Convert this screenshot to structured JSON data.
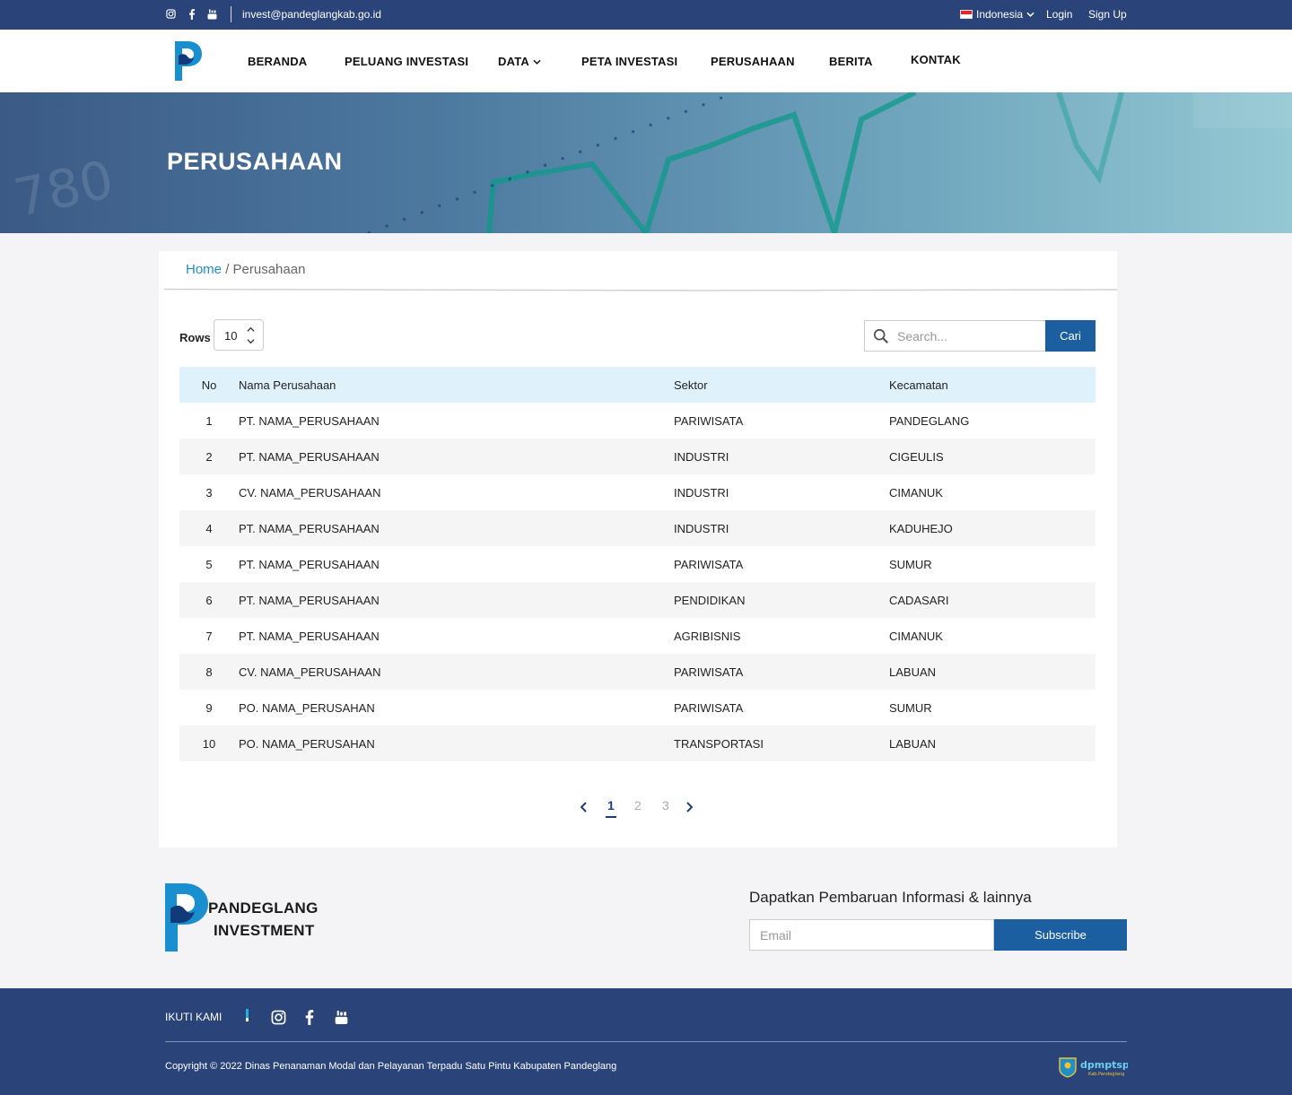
{
  "topbar": {
    "email": "invest@pandeglangkab.go.id",
    "language": "Indonesia",
    "login": "Login",
    "signup": "Sign Up",
    "social_icons": [
      "instagram-icon",
      "facebook-icon",
      "youtube-icon"
    ]
  },
  "nav": {
    "items": [
      "BERANDA",
      "PELUANG INVESTASI",
      "DATA",
      "PETA INVESTASI",
      "PERUSAHAAN",
      "BERITA",
      "KONTAK"
    ]
  },
  "hero": {
    "title": "PERUSAHAAN",
    "background_number": "780"
  },
  "breadcrumb": {
    "home": "Home",
    "separator": "/",
    "current": "Perusahaan"
  },
  "controls": {
    "rows_label": "Rows",
    "rows_value": "10",
    "search_placeholder": "Search...",
    "search_button": "Cari"
  },
  "table": {
    "headers": [
      "No",
      "Nama Perusahaan",
      "Sektor",
      "Kecamatan"
    ],
    "rows": [
      [
        "1",
        "PT. NAMA_PERUSAHAAN",
        "PARIWISATA",
        "PANDEGLANG"
      ],
      [
        "2",
        "PT. NAMA_PERUSAHAAN",
        "INDUSTRI",
        "CIGEULIS"
      ],
      [
        "3",
        "CV. NAMA_PERUSAHAAN",
        "INDUSTRI",
        "CIMANUK"
      ],
      [
        "4",
        "PT. NAMA_PERUSAHAAN",
        "INDUSTRI",
        "KADUHEJO"
      ],
      [
        "5",
        "PT. NAMA_PERUSAHAAN",
        "PARIWISATA",
        "SUMUR"
      ],
      [
        "6",
        "PT. NAMA_PERUSAHAAN",
        "PENDIDIKAN",
        "CADASARI"
      ],
      [
        "7",
        "PT. NAMA_PERUSAHAAN",
        "AGRIBISNIS",
        "CIMANUK"
      ],
      [
        "8",
        "CV. NAMA_PERUSAHAAN",
        "PARIWISATA",
        "LABUAN"
      ],
      [
        "9",
        "PO. NAMA_PERUSAHAN",
        "PARIWISATA",
        "SUMUR"
      ],
      [
        "10",
        "PO. NAMA_PERUSAHAN",
        "TRANSPORTASI",
        "LABUAN"
      ]
    ]
  },
  "pagination": {
    "prev": "‹",
    "pages": [
      "1",
      "2",
      "3"
    ],
    "next": "›",
    "current": "1"
  },
  "footer": {
    "logo_line1": "PANDEGLANG",
    "logo_line2": "INVESTMENT",
    "subscribe_title": "Dapatkan Pembaruan Informasi & lainnya",
    "email_placeholder": "Email",
    "subscribe_button": "Subscribe",
    "follow_label": "IKUTI KAMI",
    "copyright": "Copyright © 2022 Dinas Penanaman Modal dan Pelayanan Terpadu Satu Pintu Kabupaten Pandeglang",
    "agency_logo_text": "dpmptsp",
    "agency_logo_sub": "Kab.Pandeglang"
  },
  "colors": {
    "primary_dark": "#2a4479",
    "accent_blue": "#1b5fa0",
    "link_blue": "#1e8fc7",
    "table_header_bg": "#dff2fb"
  }
}
